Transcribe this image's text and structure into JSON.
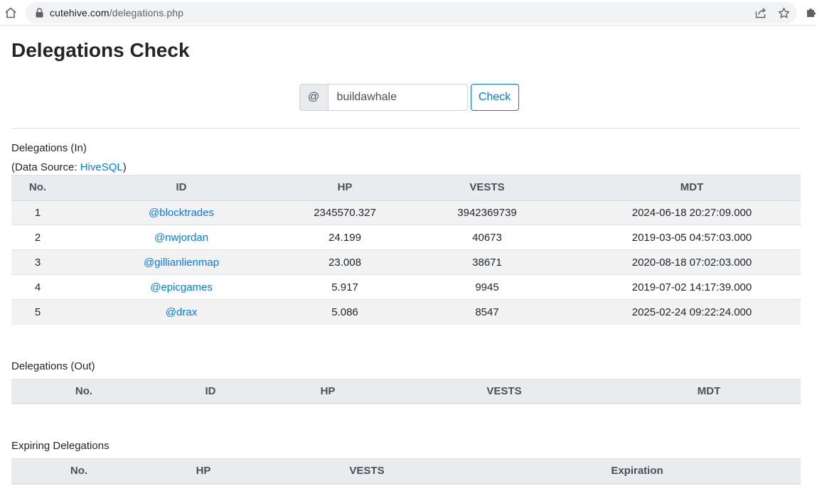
{
  "browser": {
    "url_host": "cutehive.com",
    "url_path": "/delegations.php"
  },
  "page": {
    "title": "Delegations Check"
  },
  "search": {
    "prefix": "@",
    "value": "buildawhale",
    "button_label": "Check"
  },
  "delegations_in": {
    "heading": "Delegations (In)",
    "source_prefix": "(Data Source: ",
    "source_link": "HiveSQL",
    "source_suffix": ")",
    "columns": [
      "No.",
      "ID",
      "HP",
      "VESTS",
      "MDT"
    ],
    "rows": [
      {
        "no": "1",
        "id": "@blocktrades",
        "hp": "2345570.327",
        "vests": "3942369739",
        "mdt": "2024-06-18 20:27:09.000"
      },
      {
        "no": "2",
        "id": "@nwjordan",
        "hp": "24.199",
        "vests": "40673",
        "mdt": "2019-03-05 04:57:03.000"
      },
      {
        "no": "3",
        "id": "@gillianlienmap",
        "hp": "23.008",
        "vests": "38671",
        "mdt": "2020-08-18 07:02:03.000"
      },
      {
        "no": "4",
        "id": "@epicgames",
        "hp": "5.917",
        "vests": "9945",
        "mdt": "2019-07-02 14:17:39.000"
      },
      {
        "no": "5",
        "id": "@drax",
        "hp": "5.086",
        "vests": "8547",
        "mdt": "2025-02-24 09:22:24.000"
      }
    ]
  },
  "delegations_out": {
    "heading": "Delegations (Out)",
    "columns": [
      "No.",
      "ID",
      "HP",
      "VESTS",
      "MDT"
    ]
  },
  "expiring": {
    "heading": "Expiring Delegations",
    "columns": [
      "No.",
      "HP",
      "VESTS",
      "Expiration"
    ]
  },
  "colors": {
    "link": "#007bff",
    "header_bg": "#e9ecef",
    "stripe": "#f2f2f2"
  }
}
